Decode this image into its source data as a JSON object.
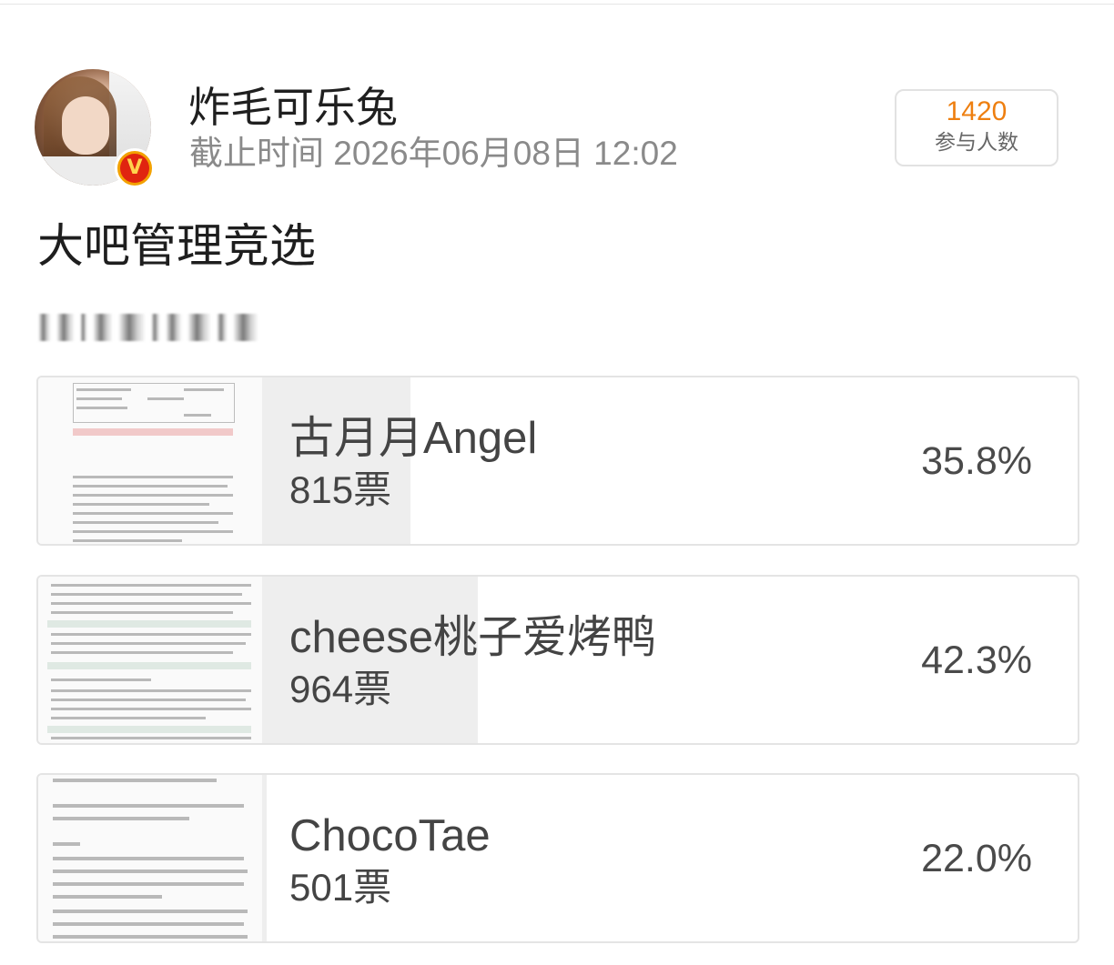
{
  "header": {
    "username": "炸毛可乐兔",
    "deadline": "截止时间 2026年06月08日 12:02",
    "participants_count": "1420",
    "participants_label": "参与人数",
    "verified_badge": "V"
  },
  "poll": {
    "title": "大吧管理竞选",
    "options": [
      {
        "name": "古月月Angel",
        "votes": "815票",
        "percent": "35.8%",
        "share": 0.358
      },
      {
        "name": "cheese桃子爱烤鸭",
        "votes": "964票",
        "percent": "42.3%",
        "share": 0.423
      },
      {
        "name": "ChocoTae",
        "votes": "501票",
        "percent": "22.0%",
        "share": 0.22
      }
    ]
  },
  "colors": {
    "accent_orange": "#ee7f10",
    "badge_yellow": "#f3a100",
    "badge_red": "#e02410",
    "bar_fill": "#eeeeee",
    "border": "#e4e4e4"
  },
  "icons": {
    "verified": "verified-v-icon"
  }
}
